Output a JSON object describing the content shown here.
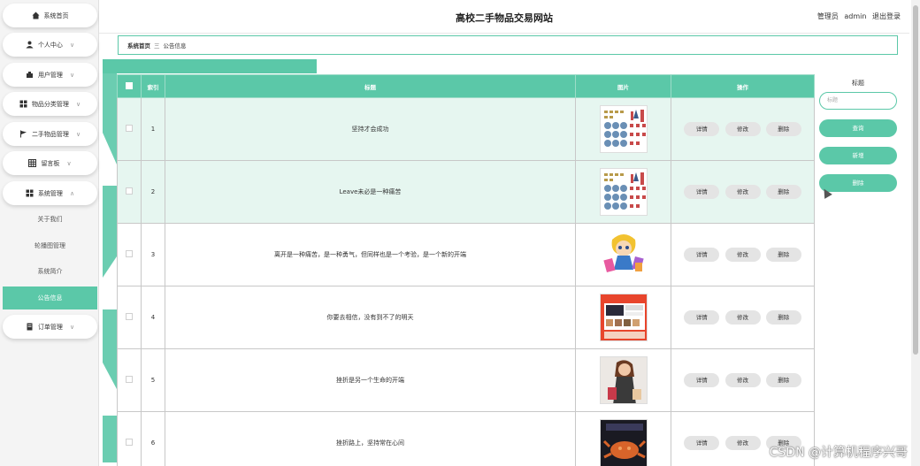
{
  "sidebar": {
    "items": [
      {
        "label": "系统首页",
        "icon": "home-icon",
        "chevron": ""
      },
      {
        "label": "个人中心",
        "icon": "user-icon",
        "chevron": "∨"
      },
      {
        "label": "用户管理",
        "icon": "users-icon",
        "chevron": "∨"
      },
      {
        "label": "物品分类管理",
        "icon": "grid-icon",
        "chevron": "∨"
      },
      {
        "label": "二手物品管理",
        "icon": "flag-icon",
        "chevron": "∨"
      },
      {
        "label": "留言板",
        "icon": "table-icon",
        "chevron": "∨"
      },
      {
        "label": "系统管理",
        "icon": "grid-icon",
        "chevron": "∧"
      }
    ],
    "sub_items": [
      {
        "label": "关于我们"
      },
      {
        "label": "轮播图管理"
      },
      {
        "label": "系统简介"
      },
      {
        "label": "公告信息"
      }
    ],
    "last_item": {
      "label": "订单管理",
      "icon": "doc-icon",
      "chevron": "∨"
    }
  },
  "header": {
    "title": "高校二手物品交易网站",
    "user_role": "管理员",
    "username": "admin",
    "logout": "退出登录"
  },
  "breadcrumb": {
    "home": "系统首页",
    "sep": "三",
    "current": "公告信息"
  },
  "table": {
    "headers": {
      "index": "索引",
      "title": "标题",
      "image": "图片",
      "actions": "操作"
    },
    "buttons": {
      "detail": "详情",
      "edit": "修改",
      "delete": "删除"
    },
    "rows": [
      {
        "index": "1",
        "title": "坚持才会成功",
        "image": "product-grid-image"
      },
      {
        "index": "2",
        "title": "Leave未必是一种痛苦",
        "image": "product-grid-image"
      },
      {
        "index": "3",
        "title": "离开是一种痛苦，是一种勇气，但同样也是一个考验，是一个新的开端",
        "image": "cartoon-shopper-image"
      },
      {
        "index": "4",
        "title": "你要去相信，没有到不了的明天",
        "image": "shopping-app-image"
      },
      {
        "index": "5",
        "title": "挫折是另一个生命的开端",
        "image": "woman-shopping-image"
      },
      {
        "index": "6",
        "title": "挫折路上，坚持常在心间",
        "image": "crab-food-image"
      }
    ]
  },
  "search": {
    "label": "标题",
    "placeholder": "标题",
    "query": "查询",
    "add": "新增",
    "delete": "删除"
  },
  "watermark": "CSDN @计算机程序兴哥",
  "colors": {
    "accent": "#5bc8a8",
    "row_highlight": "#e6f6f0"
  }
}
